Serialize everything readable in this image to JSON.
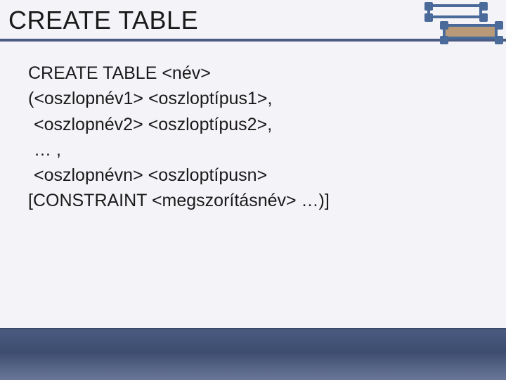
{
  "title": "CREATE TABLE",
  "lines": {
    "l1": "CREATE TABLE <név>",
    "l2": "(<oszlopnév1> <oszloptípus1>,",
    "l3": "<oszlopnév2> <oszloptípus2>,",
    "l4": "… ,",
    "l5": "<oszlopnévn> <oszloptípusn>",
    "l6": "[CONSTRAINT <megszorításnév> …)]"
  }
}
